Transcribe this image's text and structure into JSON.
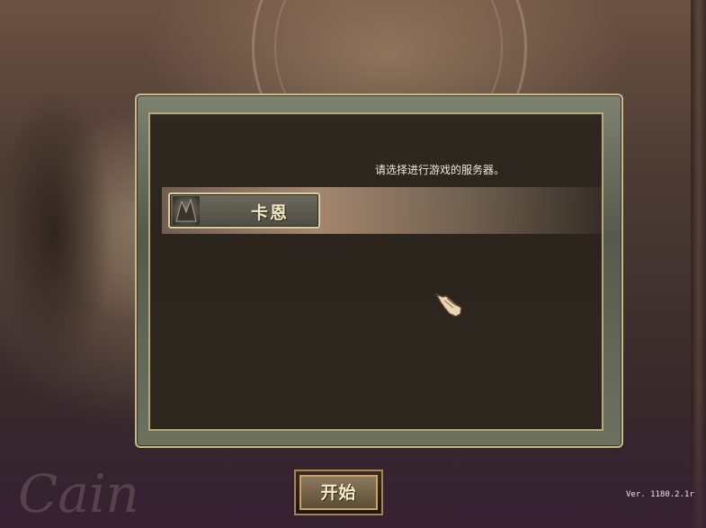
{
  "dialog": {
    "prompt": "请选择进行游戏的服务器。",
    "servers": [
      {
        "label": "卡恩",
        "icon": "server-emblem-icon"
      }
    ]
  },
  "start_button": {
    "label": "开始"
  },
  "version": "Ver. 1180.2.1r",
  "background": {
    "logo_text": "Cain"
  },
  "colors": {
    "frame_border": "#c9b98a",
    "dialog_bg": "#2a2118",
    "server_row_highlight": "#aa8c73",
    "text_light": "#f0e8d8"
  }
}
